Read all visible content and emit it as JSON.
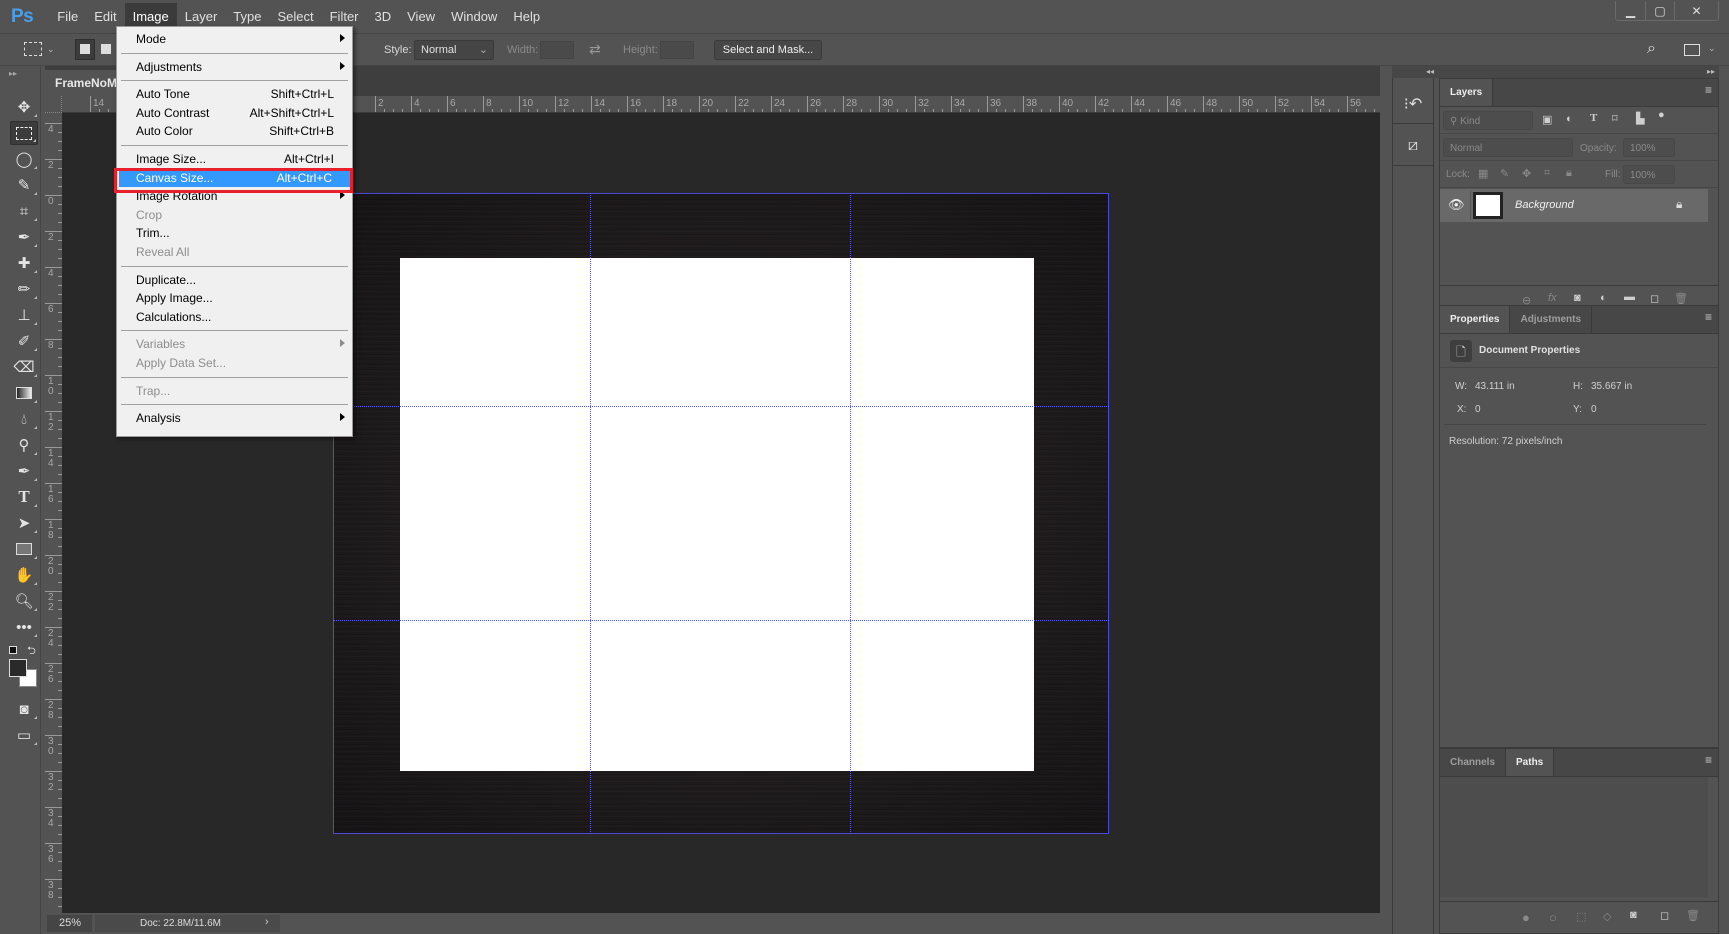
{
  "app": {
    "logo": "Ps"
  },
  "menubar": {
    "items": [
      "File",
      "Edit",
      "Image",
      "Layer",
      "Type",
      "Select",
      "Filter",
      "3D",
      "View",
      "Window",
      "Help"
    ],
    "active": "Image"
  },
  "window_controls": {
    "minimize": "▁",
    "maximize": "▢",
    "close": "✕"
  },
  "options": {
    "style_label": "Style:",
    "style_value": "Normal",
    "width_label": "Width:",
    "height_label": "Height:",
    "select_mask": "Select and Mask..."
  },
  "document": {
    "tab_title": "FrameNoMat",
    "zoom": "25%",
    "doc_info": "Doc: 22.8M/11.6M",
    "hruler_labels": [
      "14",
      "2",
      "4",
      "6",
      "8",
      "10",
      "12",
      "14",
      "16",
      "18",
      "20",
      "22",
      "24",
      "26",
      "28",
      "30",
      "32",
      "34",
      "36",
      "38",
      "40",
      "42",
      "44",
      "46",
      "48",
      "50",
      "52",
      "54",
      "56"
    ],
    "vruler_labels": [
      "4",
      "2",
      "0",
      "2",
      "4",
      "6",
      "8",
      "10",
      "12",
      "14",
      "16",
      "18",
      "20",
      "22",
      "24",
      "26",
      "28",
      "30",
      "32",
      "34",
      "36",
      "38"
    ]
  },
  "image_menu": {
    "items": [
      {
        "label": "Mode",
        "submenu": true
      },
      {
        "sep": true
      },
      {
        "label": "Adjustments",
        "submenu": true
      },
      {
        "sep": true
      },
      {
        "label": "Auto Tone",
        "shortcut": "Shift+Ctrl+L"
      },
      {
        "label": "Auto Contrast",
        "shortcut": "Alt+Shift+Ctrl+L"
      },
      {
        "label": "Auto Color",
        "shortcut": "Shift+Ctrl+B"
      },
      {
        "sep": true
      },
      {
        "label": "Image Size...",
        "shortcut": "Alt+Ctrl+I"
      },
      {
        "label": "Canvas Size...",
        "shortcut": "Alt+Ctrl+C",
        "highlighted": true
      },
      {
        "label": "Image Rotation",
        "submenu": true
      },
      {
        "label": "Crop",
        "disabled": true
      },
      {
        "label": "Trim..."
      },
      {
        "label": "Reveal All",
        "disabled": true
      },
      {
        "sep": true
      },
      {
        "label": "Duplicate..."
      },
      {
        "label": "Apply Image..."
      },
      {
        "label": "Calculations..."
      },
      {
        "sep": true
      },
      {
        "label": "Variables",
        "submenu": true,
        "disabled": true
      },
      {
        "label": "Apply Data Set...",
        "disabled": true
      },
      {
        "sep": true
      },
      {
        "label": "Trap...",
        "disabled": true
      },
      {
        "sep": true
      },
      {
        "label": "Analysis",
        "submenu": true
      }
    ]
  },
  "layers_panel": {
    "tab": "Layers",
    "filter_kind": "Kind",
    "blend_mode": "Normal",
    "opacity_label": "Opacity:",
    "opacity_value": "100%",
    "lock_label": "Lock:",
    "fill_label": "Fill:",
    "fill_value": "100%",
    "layers": [
      {
        "name": "Background",
        "visible": true,
        "locked": true
      }
    ]
  },
  "properties_panel": {
    "tabs": [
      "Properties",
      "Adjustments"
    ],
    "active_tab": "Properties",
    "title": "Document Properties",
    "w_label": "W:",
    "w_value": "43.111 in",
    "h_label": "H:",
    "h_value": "35.667 in",
    "x_label": "X:",
    "x_value": "0",
    "y_label": "Y:",
    "y_value": "0",
    "resolution": "Resolution: 72 pixels/inch"
  },
  "paths_panel": {
    "tabs": [
      "Channels",
      "Paths"
    ],
    "active_tab": "Paths"
  },
  "colors": {
    "highlight": "#3399ff",
    "annotation_box": "#e8202b",
    "guide": "#5c5cf0",
    "logo": "#4a9ee8"
  }
}
